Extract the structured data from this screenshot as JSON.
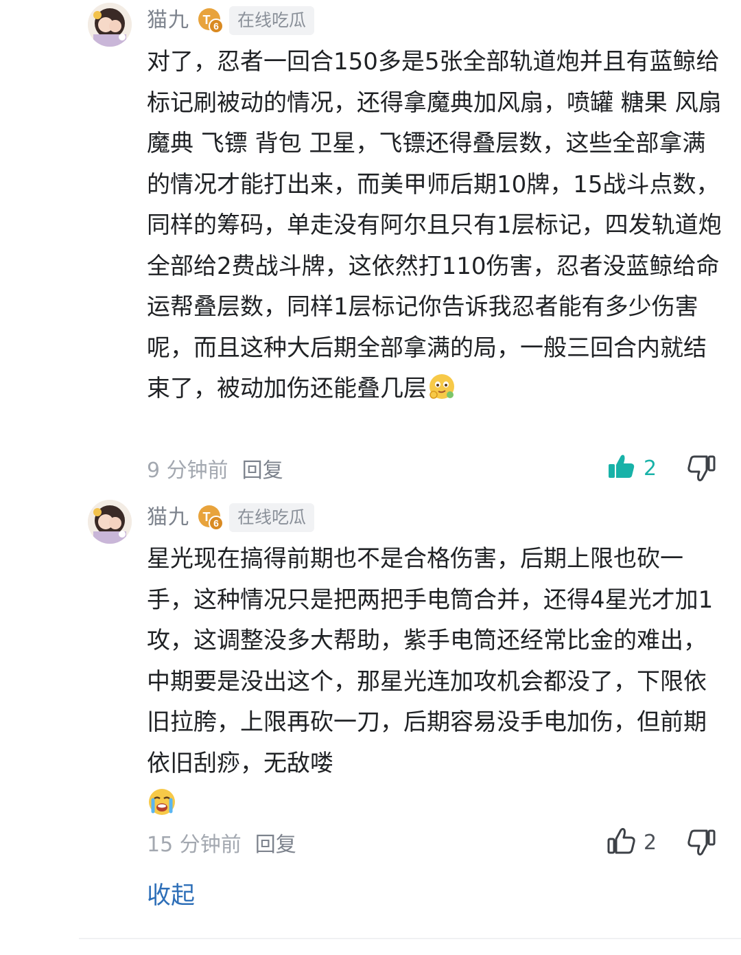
{
  "comments": [
    {
      "username": "猫九",
      "level_badge": "T6",
      "tag": "在线吃瓜",
      "text": "对了，忍者一回合150多是5张全部轨道炮并且有蓝鲸给标记刷被动的情况，还得拿魔典加风扇，喷罐 糖果 风扇 魔典 飞镖 背包 卫星，飞镖还得叠层数，这些全部拿满的情况才能打出来，而美甲师后期10牌，15战斗点数，同样的筹码，单走没有阿尔且只有1层标记，四发轨道炮全部给2费战斗牌，这依然打110伤害，忍者没蓝鲸给命运帮叠层数，同样1层标记你告诉我忍者能有多少伤害呢，而且这种大后期全部拿满的局，一般三回合内就结束了，被动加伤还能叠几层",
      "emoji": "thinking-face-emoji",
      "time": "9 分钟前",
      "reply_label": "回复",
      "likes": "2",
      "liked": true
    },
    {
      "username": "猫九",
      "level_badge": "T6",
      "tag": "在线吃瓜",
      "text": "星光现在搞得前期也不是合格伤害，后期上限也砍一手，这种情况只是把两把手电筒合并，还得4星光才加1攻，这调整没多大帮助，紫手电筒还经常比金的难出，中期要是没出这个，那星光连加攻机会都没了，下限依旧拉胯，上限再砍一刀，后期容易没手电加伤，但前期依旧刮痧，无敌喽",
      "emoji": "crying-face-emoji",
      "time": "15 分钟前",
      "reply_label": "回复",
      "likes": "2",
      "liked": false
    }
  ],
  "collapse_label": "收起",
  "colors": {
    "accent_like": "#18b2a8",
    "link": "#2e6fb8",
    "badge": "#e8a33c"
  }
}
